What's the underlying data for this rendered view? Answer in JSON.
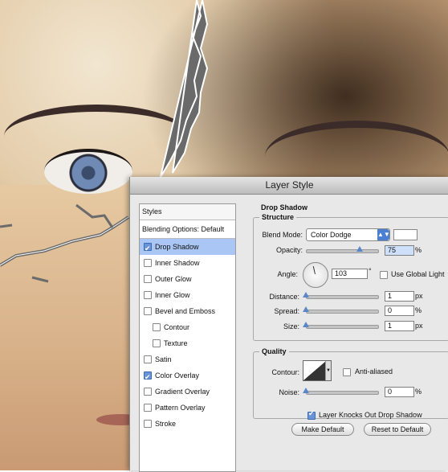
{
  "dialog": {
    "title": "Layer Style"
  },
  "styles_panel": {
    "header": "Styles",
    "blending_options": "Blending Options: Default",
    "items": [
      {
        "label": "Drop Shadow",
        "checked": true,
        "selected": true
      },
      {
        "label": "Inner Shadow",
        "checked": false
      },
      {
        "label": "Outer Glow",
        "checked": false
      },
      {
        "label": "Inner Glow",
        "checked": false
      },
      {
        "label": "Bevel and Emboss",
        "checked": false
      },
      {
        "label": "Contour",
        "checked": false,
        "indent": true
      },
      {
        "label": "Texture",
        "checked": false,
        "indent": true
      },
      {
        "label": "Satin",
        "checked": false
      },
      {
        "label": "Color Overlay",
        "checked": true
      },
      {
        "label": "Gradient Overlay",
        "checked": false
      },
      {
        "label": "Pattern Overlay",
        "checked": false
      },
      {
        "label": "Stroke",
        "checked": false
      }
    ]
  },
  "drop_shadow": {
    "section_title": "Drop Shadow",
    "structure": {
      "title": "Structure",
      "blend_mode_label": "Blend Mode:",
      "blend_mode_value": "Color Dodge",
      "shadow_color": "#ffffff",
      "opacity_label": "Opacity:",
      "opacity_value": "75",
      "opacity_unit": "%",
      "opacity_level": 0.75,
      "angle_label": "Angle:",
      "angle_value": "103",
      "angle_unit": "°",
      "use_global_light_label": "Use Global Light",
      "use_global_light_checked": false,
      "distance_label": "Distance:",
      "distance_value": "1",
      "distance_unit": "px",
      "spread_label": "Spread:",
      "spread_value": "0",
      "spread_unit": "%",
      "size_label": "Size:",
      "size_value": "1",
      "size_unit": "px"
    },
    "quality": {
      "title": "Quality",
      "contour_label": "Contour:",
      "anti_aliased_label": "Anti-aliased",
      "anti_aliased_checked": false,
      "noise_label": "Noise:",
      "noise_value": "0",
      "noise_unit": "%"
    },
    "knocks_out_label": "Layer Knocks Out Drop Shadow",
    "knocks_out_checked": true,
    "make_default_label": "Make Default",
    "reset_default_label": "Reset to Default"
  },
  "colors": {
    "selection": "#a9c6f4",
    "accent": "#4a7fd1"
  }
}
